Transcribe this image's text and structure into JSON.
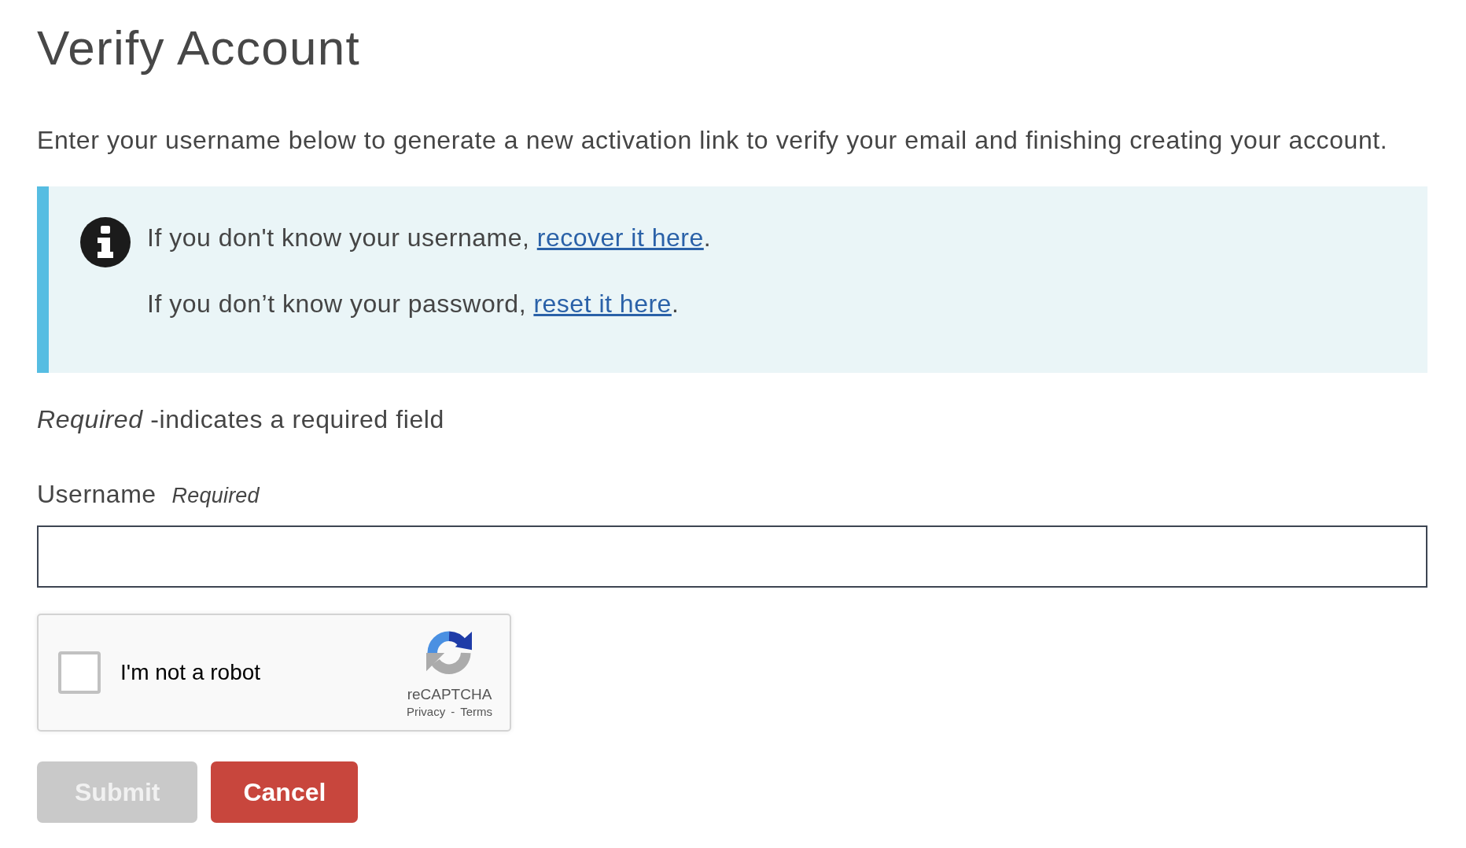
{
  "page": {
    "title": "Verify Account",
    "intro": "Enter your username below to generate a new activation link to verify your email and finishing creating your account."
  },
  "notice": {
    "lines": [
      {
        "text": "If you don't know your username, ",
        "link": "recover it here",
        "after": "."
      },
      {
        "text": "If you don’t know your password, ",
        "link": "reset it here",
        "after": "."
      }
    ]
  },
  "required_note": "*Required* -indicates a required field",
  "form": {
    "fields": [
      {
        "label": "Username",
        "hint": "Required"
      }
    ]
  },
  "captcha": {
    "label": "I'm not a robot",
    "checked": false,
    "brand": "reCAPTCHA",
    "links": [
      "Privacy",
      "Terms"
    ],
    "separator": "-"
  },
  "buttons": [
    {
      "label": "Submit",
      "kind": "primary",
      "disabled": true
    },
    {
      "label": "Cancel",
      "kind": "danger",
      "disabled": false
    }
  ]
}
